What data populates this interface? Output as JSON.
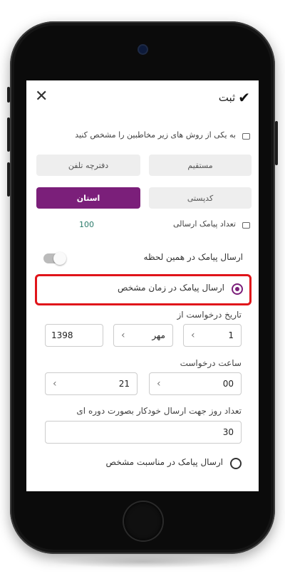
{
  "header": {
    "title": "ثبت",
    "check_icon": "✔",
    "close_icon": "✕"
  },
  "recipients": {
    "prompt": "به یکی از روش های زیر مخاطبین را مشخص کنید",
    "options": [
      "مستقیم",
      "دفترچه تلفن",
      "کدپستی",
      "استان"
    ],
    "selected": "استان"
  },
  "sms_count": {
    "label": "تعداد پیامک ارسالی",
    "value": "100"
  },
  "send_now": {
    "label": "ارسال پیامک در همین لحظه",
    "enabled": false
  },
  "send_scheduled": {
    "label": "ارسال پیامک در زمان مشخص",
    "selected": true
  },
  "request_date": {
    "label": "تاریخ درخواست از",
    "day": "1",
    "month": "مهر",
    "year": "1398"
  },
  "request_time": {
    "label": "ساعت درخواست",
    "hour": "21",
    "minute": "00"
  },
  "auto_days": {
    "label": "تعداد روز جهت ارسال خودکار بصورت دوره ای",
    "value": "30"
  },
  "send_occasion": {
    "label": "ارسال پیامک در مناسبت مشخص",
    "selected": false
  },
  "colors": {
    "accent": "#7b1f7a",
    "highlight": "#e0141a",
    "count": "#2a7a6a"
  }
}
